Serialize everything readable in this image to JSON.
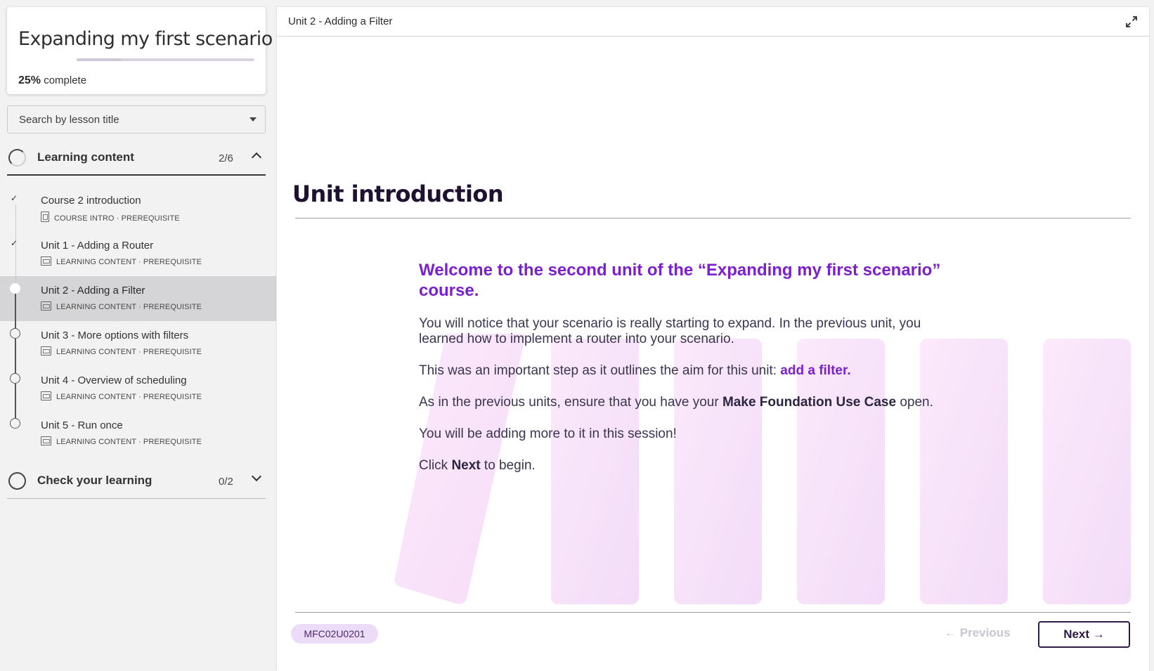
{
  "course": {
    "title": "Expanding my first scenario",
    "progress_value": "25%",
    "progress_suffix": "complete",
    "progress_fraction": 0.25
  },
  "search": {
    "placeholder": "Search by lesson title"
  },
  "sections": [
    {
      "label": "Learning content",
      "count": "2/6",
      "expanded": true
    },
    {
      "label": "Check your learning",
      "count": "0/2",
      "expanded": false
    }
  ],
  "lessons": [
    {
      "title": "Course 2 introduction",
      "meta": "COURSE INTRO · PREREQUISITE",
      "status": "done",
      "icon": "document-icon"
    },
    {
      "title": "Unit 1 - Adding a Router",
      "meta": "LEARNING CONTENT · PREREQUISITE",
      "status": "done",
      "icon": "slides-icon"
    },
    {
      "title": "Unit 2 - Adding a Filter",
      "meta": "LEARNING CONTENT · PREREQUISITE",
      "status": "current",
      "icon": "slides-icon"
    },
    {
      "title": "Unit 3 - More options with filters",
      "meta": "LEARNING CONTENT · PREREQUISITE",
      "status": "todo",
      "icon": "slides-icon"
    },
    {
      "title": "Unit 4 - Overview of scheduling",
      "meta": "LEARNING CONTENT · PREREQUISITE",
      "status": "todo",
      "icon": "slides-icon"
    },
    {
      "title": "Unit 5 - Run once",
      "meta": "LEARNING CONTENT · PREREQUISITE",
      "status": "todo",
      "icon": "slides-icon"
    }
  ],
  "main": {
    "breadcrumb": "Unit 2 - Adding a Filter",
    "unit_title": "Unit introduction",
    "heading": "Welcome to the second unit of the “Expanding my first scenario” course.",
    "p1": "You will notice that your scenario is really starting to expand. In the previous unit, you learned how to implement a router into your scenario.",
    "p2_before": "This was an important step as it outlines the aim for this unit: ",
    "p2_link": "add a filter.",
    "p3_before": "As in the previous units, ensure that you have your ",
    "p3_bold": "Make Foundation Use Case",
    "p3_after": " open.",
    "p4": "You will be adding more to it in this session!",
    "p5_before": "Click ",
    "p5_bold": "Next",
    "p5_after": " to begin.",
    "code": "MFC02U0201",
    "prev_label": "Previous",
    "next_label": "Next"
  },
  "colors": {
    "accent": "#7b1fcf",
    "dark": "#2e1a47",
    "badge_bg": "#ecdcf7"
  }
}
